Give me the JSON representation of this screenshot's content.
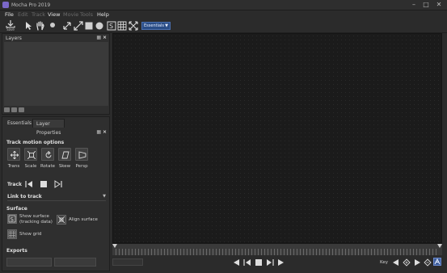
{
  "window": {
    "title": "Mocha Pro 2019",
    "controls": [
      "minimize",
      "maximize",
      "close"
    ]
  },
  "menu": {
    "items": [
      {
        "label": "File",
        "enabled": true
      },
      {
        "label": "Edit",
        "enabled": false
      },
      {
        "label": "Track",
        "enabled": false
      },
      {
        "label": "View",
        "enabled": true
      },
      {
        "label": "Movie",
        "enabled": false
      },
      {
        "label": "Tools",
        "enabled": false
      },
      {
        "label": "Help",
        "enabled": true
      }
    ]
  },
  "toolbar": {
    "save_label": "Save",
    "workspace": "Essentials",
    "tools": [
      "pointer-icon",
      "hand-icon",
      "circle-dot-icon",
      "resize-icon",
      "expand-icon",
      "square-icon",
      "circle-icon",
      "surface-icon",
      "grid-icon",
      "transform-icon"
    ]
  },
  "layers_panel": {
    "title": "Layers",
    "tool_icons": [
      "add-layer-icon",
      "duplicate-layer-icon",
      "delete-layer-icon"
    ]
  },
  "params_panel": {
    "tabs": [
      {
        "label": "Essentials",
        "active": false
      },
      {
        "label": "Layer Properties",
        "active": true
      }
    ],
    "track_motion": {
      "title": "Track motion options",
      "options": [
        {
          "label": "Trans",
          "icon": "translate-icon"
        },
        {
          "label": "Scale",
          "icon": "scale-icon"
        },
        {
          "label": "Rotate",
          "icon": "rotate-icon"
        },
        {
          "label": "Skew",
          "icon": "skew-icon"
        },
        {
          "label": "Persp",
          "icon": "perspective-icon"
        }
      ]
    },
    "track": {
      "label": "Track",
      "buttons": [
        "track-backward-icon",
        "stop-icon",
        "track-forward-icon"
      ]
    },
    "link_to_track": {
      "label": "Link to track",
      "value": ""
    },
    "surface": {
      "title": "Surface",
      "show_surface_label_line1": "Show surface",
      "show_surface_label_line2": "(tracking data)",
      "align_surface_label": "Align surface",
      "show_grid_label": "Show grid"
    },
    "exports": {
      "title": "Exports",
      "buttons": [
        "",
        ""
      ]
    }
  },
  "transport": {
    "key_label": "Key",
    "buttons": [
      "play-backward-icon",
      "step-back-icon",
      "stop-icon",
      "step-forward-icon",
      "play-forward-icon"
    ],
    "key_buttons": [
      "prev-key-icon",
      "add-key-icon",
      "next-key-icon",
      "delete-key-icon",
      "auto-key-icon"
    ]
  },
  "colors": {
    "accent": "#2a4d86",
    "viewer_bg": "#1b1b1b",
    "panel_bg": "#2f2f2f"
  }
}
